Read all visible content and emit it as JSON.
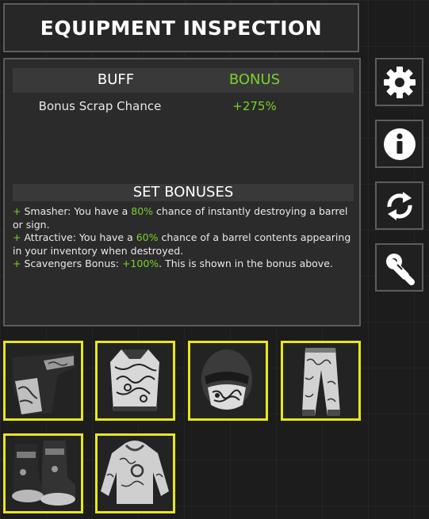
{
  "title": "EQUIPMENT INSPECTION",
  "buff_table": {
    "header_buff": "BUFF",
    "header_bonus": "BONUS",
    "rows": [
      {
        "buff": "Bonus Scrap Chance",
        "bonus": "+275%"
      }
    ]
  },
  "set_bonuses": {
    "header": "SET BONUSES",
    "items": [
      {
        "prefix": "+",
        "pre": " Smasher: You have a ",
        "highlight": "80%",
        "post": " chance of instantly destroying a barrel or sign."
      },
      {
        "prefix": "+",
        "pre": " Attractive: You have a ",
        "highlight": "60%",
        "post": " chance of a barrel contents appearing in your inventory when destroyed."
      },
      {
        "prefix": "+",
        "pre": " Scavengers Bonus: ",
        "highlight": "+100%",
        "post": ". This is shown in the bonus above."
      }
    ]
  },
  "side_buttons": [
    {
      "icon": "gear-icon"
    },
    {
      "icon": "info-icon"
    },
    {
      "icon": "swap-icon"
    },
    {
      "icon": "grinder-icon"
    }
  ],
  "equipment_slots": [
    {
      "item": "kilt-icon"
    },
    {
      "item": "chestplate-icon"
    },
    {
      "item": "facemask-icon"
    },
    {
      "item": "pants-icon"
    },
    {
      "item": "boots-icon"
    },
    {
      "item": "hoodie-icon"
    }
  ],
  "colors": {
    "accent_green": "#7bd12c",
    "slot_highlight": "#e8e61a",
    "border": "#5c5e5c"
  }
}
